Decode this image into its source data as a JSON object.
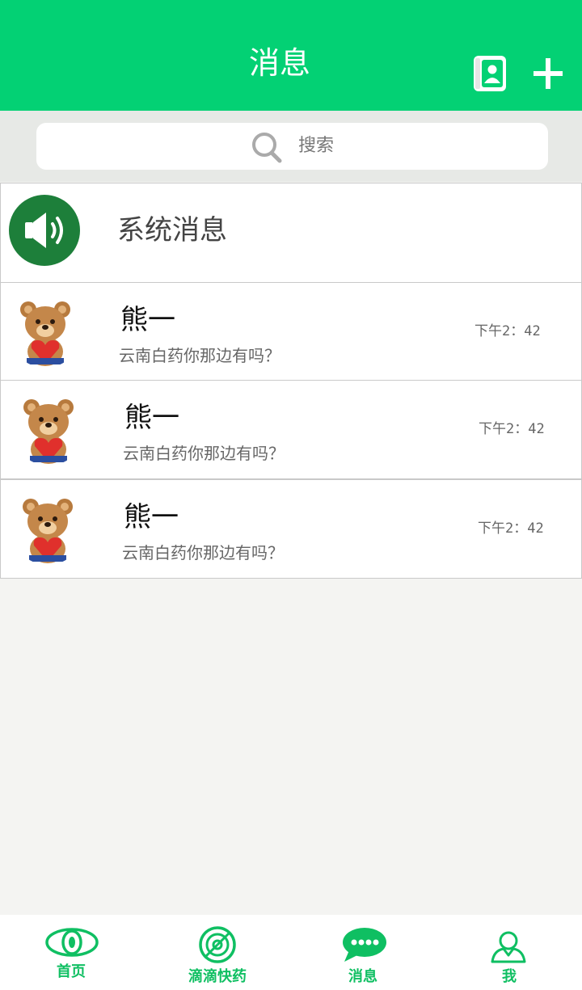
{
  "header": {
    "title": "消息",
    "contacts_icon": "contacts-icon",
    "add_icon": "plus-icon"
  },
  "search": {
    "placeholder": "搜索",
    "icon": "search-icon"
  },
  "system": {
    "label": "系统消息",
    "icon": "speaker-icon"
  },
  "messages": [
    {
      "name": "熊一",
      "preview": "云南白药你那边有吗？",
      "time": "下午2：42"
    },
    {
      "name": "熊一",
      "preview": "云南白药你那边有吗？",
      "time": "下午2：42"
    },
    {
      "name": "熊一",
      "preview": "云南白药你那边有吗？",
      "time": "下午2：42"
    }
  ],
  "tabs": [
    {
      "label": "首页",
      "icon": "eye-icon"
    },
    {
      "label": "滴滴快药",
      "icon": "radar-icon"
    },
    {
      "label": "消息",
      "icon": "chat-bubble-icon"
    },
    {
      "label": "我",
      "icon": "person-icon"
    }
  ],
  "colors": {
    "brand": "#03d174",
    "tab_active": "#0fbf62",
    "system_icon_bg": "#1d7f3a"
  }
}
